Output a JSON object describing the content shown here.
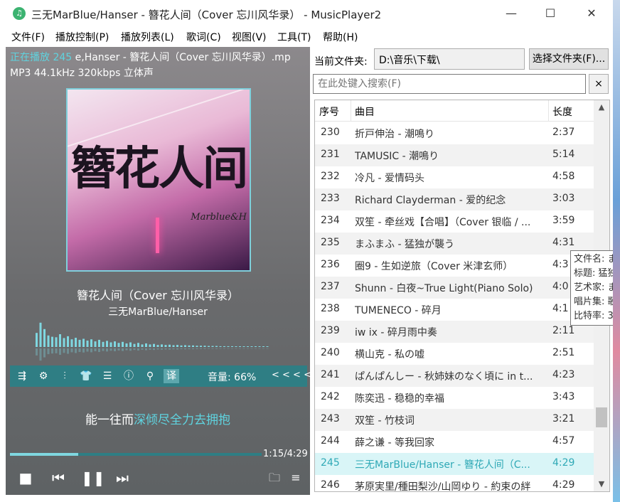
{
  "window": {
    "title": "三无MarBlue/Hanser - 簪花人间（Cover 忘川风华录） - MusicPlayer2",
    "app_icon": "music-note-icon"
  },
  "menu": [
    {
      "label": "文件(F)"
    },
    {
      "label": "播放控制(P)"
    },
    {
      "label": "播放列表(L)"
    },
    {
      "label": "歌词(C)"
    },
    {
      "label": "视图(V)"
    },
    {
      "label": "工具(T)"
    },
    {
      "label": "帮助(H)"
    }
  ],
  "player": {
    "now_playing_prefix": "正在播放 245",
    "now_playing_text": "e,Hanser - 簪花人间（Cover 忘川风华录）.mp",
    "format_info": "MP3 44.1kHz 320kbps 立体声",
    "cover_title": "簪花人间",
    "cover_sub": "Marblue&H",
    "song_title": "簪花人间（Cover 忘川风华录）",
    "artist": "三无MarBlue/Hanser",
    "volume_label": "音量: 66%",
    "volume_arrows": "< < < <",
    "lyric_played": "能一往而",
    "lyric_upcoming": "深倾尽全力去拥抱",
    "progress": 0.27,
    "time_display": "1:15/4:29",
    "spectrum_levels": [
      0.55,
      0.95,
      0.7,
      0.45,
      0.4,
      0.38,
      0.5,
      0.35,
      0.42,
      0.3,
      0.36,
      0.28,
      0.32,
      0.25,
      0.3,
      0.22,
      0.28,
      0.2,
      0.24,
      0.18,
      0.22,
      0.16,
      0.2,
      0.14,
      0.18,
      0.12,
      0.16,
      0.1,
      0.14,
      0.1,
      0.12,
      0.08,
      0.1,
      0.08,
      0.09,
      0.07,
      0.08,
      0.06,
      0.07,
      0.06,
      0.06,
      0.05,
      0.05,
      0.05,
      0.04,
      0.04,
      0.04,
      0.03,
      0.03,
      0.03,
      0.03,
      0.02,
      0.02,
      0.02,
      0.02,
      0.02,
      0.02,
      0.02,
      0.02,
      0.02
    ],
    "toolbar_icons": [
      "playlist-icon",
      "settings-icon",
      "equalizer-icon",
      "skin-icon",
      "menu-icon",
      "info-icon",
      "search-icon",
      "translate-icon"
    ],
    "translate_label": "译"
  },
  "folder": {
    "label": "当前文件夹:",
    "path": "D:\\音乐\\下载\\",
    "select_button": "选择文件夹(F)..."
  },
  "search": {
    "placeholder": "在此处键入搜索(F)",
    "clear_label": "×"
  },
  "playlist": {
    "headers": {
      "num": "序号",
      "title": "曲目",
      "length": "长度"
    },
    "rows": [
      {
        "num": "230",
        "title": "折戸伸治 - 潮鳴り",
        "length": "2:37"
      },
      {
        "num": "231",
        "title": "TAMUSIC - 潮鳴り",
        "length": "5:14"
      },
      {
        "num": "232",
        "title": "冷凡 - 爱情码头",
        "length": "4:58"
      },
      {
        "num": "233",
        "title": "Richard Clayderman - 爱的纪念",
        "length": "3:03"
      },
      {
        "num": "234",
        "title": "双笙 - 牵丝戏【合唱】（Cover 银临 / ...",
        "length": "3:59"
      },
      {
        "num": "235",
        "title": "まふまふ - 猛独が襲う",
        "length": "4:31"
      },
      {
        "num": "236",
        "title": "圈9 - 生如逆旅（Cover 米津玄师）",
        "length": "4:3"
      },
      {
        "num": "237",
        "title": "Shunn - 白夜~True Light(Piano Solo)",
        "length": "4:0"
      },
      {
        "num": "238",
        "title": "TUMENECO - 碎月",
        "length": "4:1"
      },
      {
        "num": "239",
        "title": "iw ix - 碎月雨中奏",
        "length": "2:11"
      },
      {
        "num": "240",
        "title": "横山克 - 私の嘘",
        "length": "2:51"
      },
      {
        "num": "241",
        "title": "ぱんぱんしー - 秋姉妹のなく頃に in t...",
        "length": "4:23"
      },
      {
        "num": "242",
        "title": "陈奕迅 - 稳稳的幸福",
        "length": "3:43"
      },
      {
        "num": "243",
        "title": "双笙 - 竹枝词",
        "length": "3:21"
      },
      {
        "num": "244",
        "title": "薛之谦 - 等我回家",
        "length": "4:57"
      },
      {
        "num": "245",
        "title": "三无MarBlue/Hanser - 簪花人间（C...",
        "length": "4:29"
      },
      {
        "num": "246",
        "title": "茅原実里/種田梨沙/山岡ゆり - 約束の絆",
        "length": "4:29"
      }
    ]
  },
  "tooltip": {
    "lines": [
      "文件名: ま",
      "标题: 猛独",
      "艺术家: ま",
      "唱片集: 歌",
      "比特率: 32"
    ]
  }
}
